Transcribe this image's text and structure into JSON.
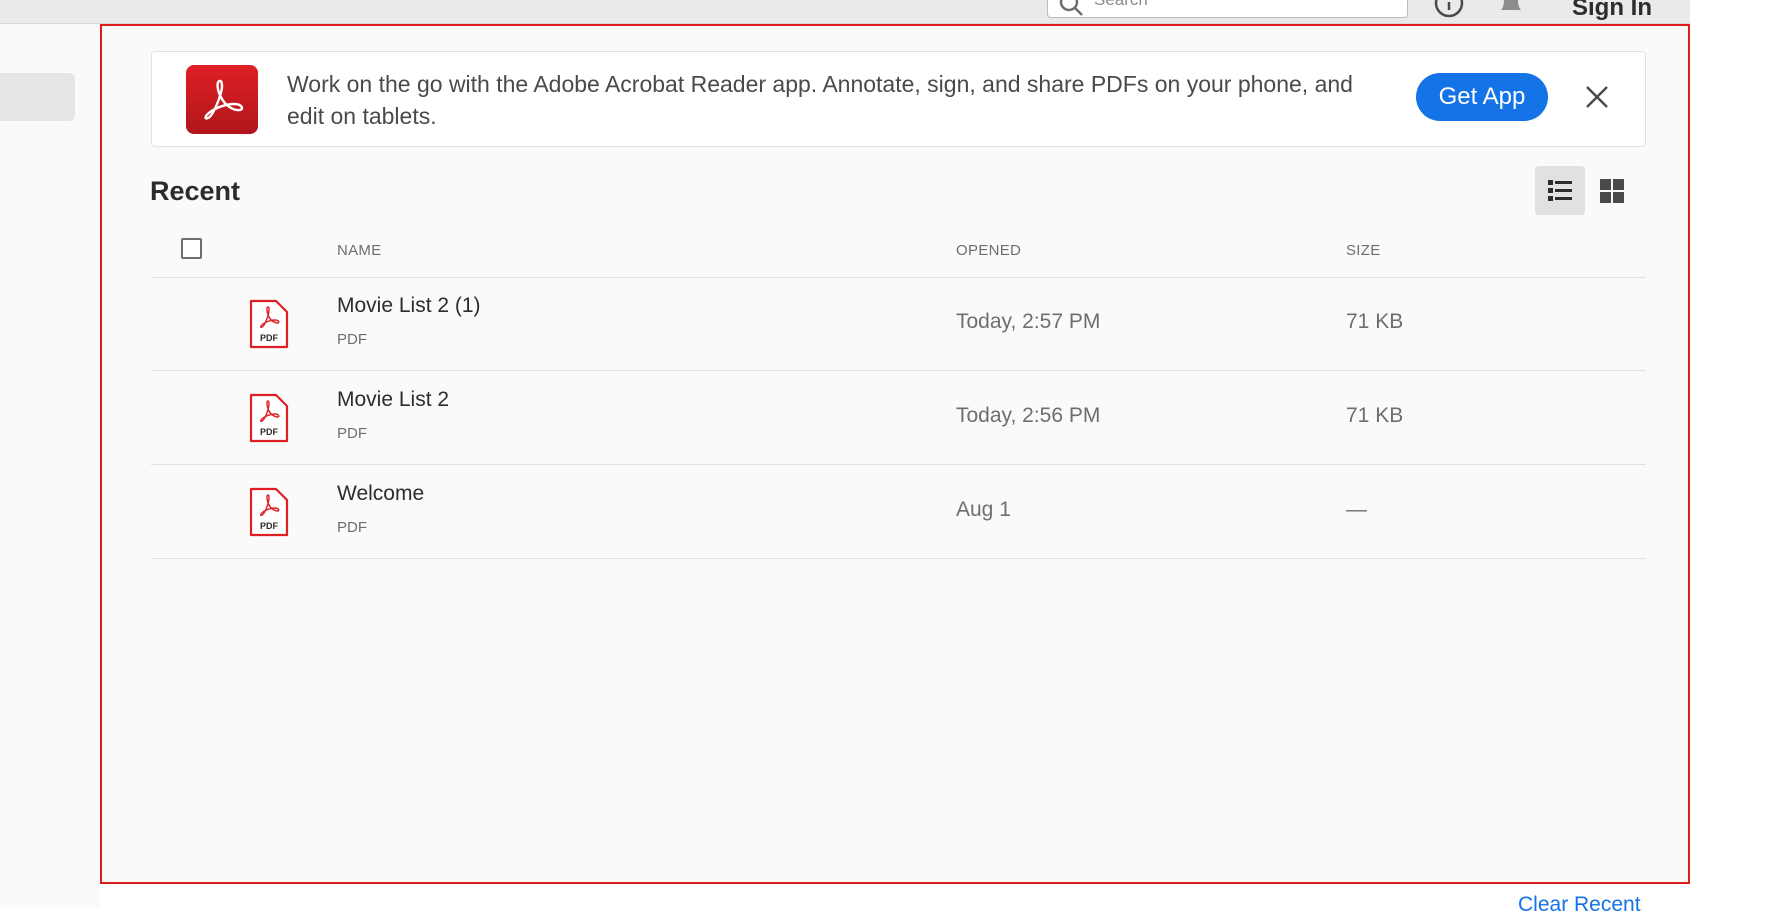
{
  "topbar": {
    "search_placeholder": "Search",
    "signin_label": "Sign In"
  },
  "banner": {
    "text": "Work on the go with the Adobe Acrobat Reader app. Annotate, sign, and share PDFs on your phone, and edit on tablets.",
    "button_label": "Get App"
  },
  "recent": {
    "title": "Recent",
    "columns": {
      "name": "NAME",
      "opened": "OPENED",
      "size": "SIZE"
    },
    "files": [
      {
        "name": "Movie List 2 (1)",
        "type": "PDF",
        "opened": "Today, 2:57 PM",
        "size": "71 KB"
      },
      {
        "name": "Movie List 2",
        "type": "PDF",
        "opened": "Today, 2:56 PM",
        "size": "71 KB"
      },
      {
        "name": "Welcome",
        "type": "PDF",
        "opened": "Aug 1",
        "size": "—"
      }
    ],
    "clear_label": "Clear Recent"
  },
  "icons": {
    "file": "pdf-file-icon",
    "banner": "acrobat-logo-icon",
    "close": "close-icon",
    "list_view": "list-view-icon",
    "grid_view": "grid-view-icon"
  },
  "colors": {
    "accent": "#1473e6",
    "brand_red": "#e01f25",
    "focus_border": "#e01d1d"
  }
}
